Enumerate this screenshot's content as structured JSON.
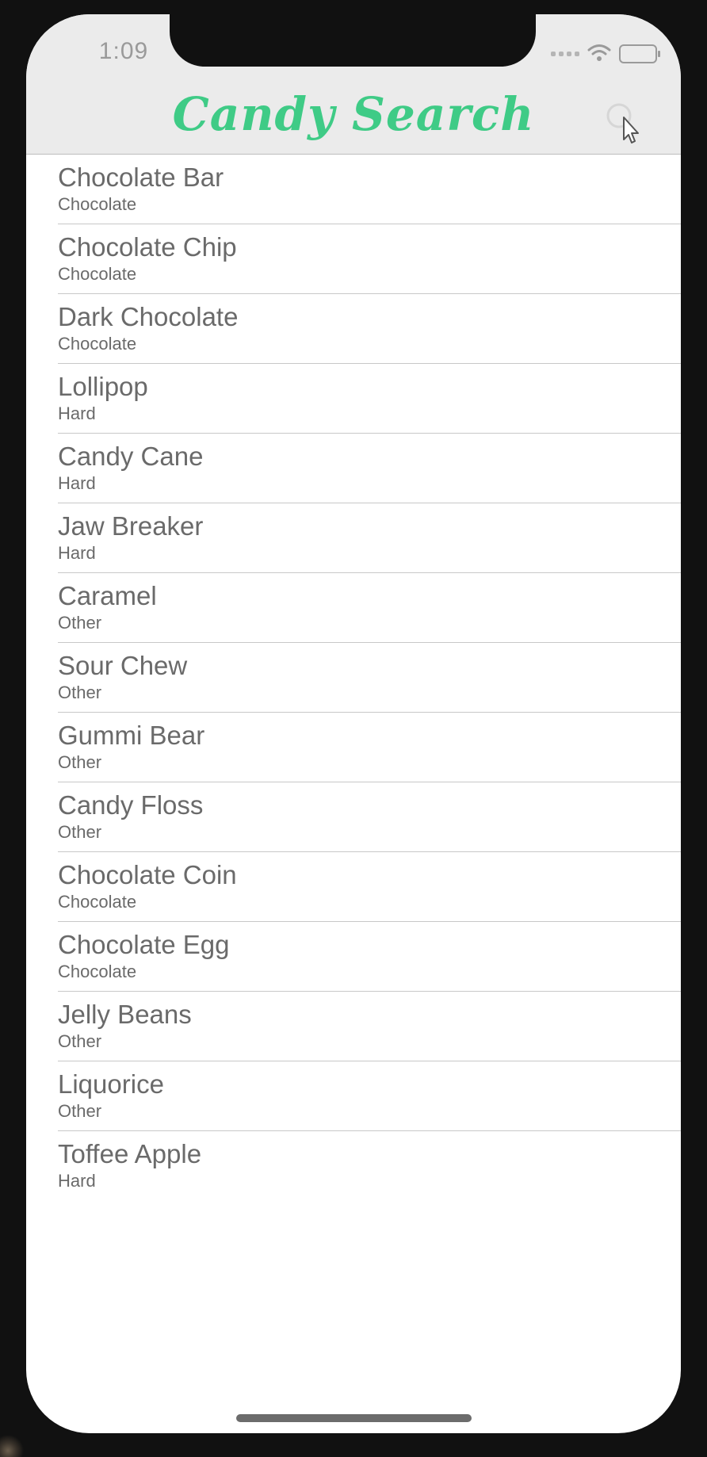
{
  "status_bar": {
    "time": "1:09"
  },
  "nav": {
    "title": "Candy Search",
    "title_color": "#3fcb86",
    "search_icon": "search-icon"
  },
  "candies": [
    {
      "name": "Chocolate Bar",
      "category": "Chocolate"
    },
    {
      "name": "Chocolate Chip",
      "category": "Chocolate"
    },
    {
      "name": "Dark Chocolate",
      "category": "Chocolate"
    },
    {
      "name": "Lollipop",
      "category": "Hard"
    },
    {
      "name": "Candy Cane",
      "category": "Hard"
    },
    {
      "name": "Jaw Breaker",
      "category": "Hard"
    },
    {
      "name": "Caramel",
      "category": "Other"
    },
    {
      "name": "Sour Chew",
      "category": "Other"
    },
    {
      "name": "Gummi Bear",
      "category": "Other"
    },
    {
      "name": "Candy Floss",
      "category": "Other"
    },
    {
      "name": "Chocolate Coin",
      "category": "Chocolate"
    },
    {
      "name": "Chocolate Egg",
      "category": "Chocolate"
    },
    {
      "name": "Jelly Beans",
      "category": "Other"
    },
    {
      "name": "Liquorice",
      "category": "Other"
    },
    {
      "name": "Toffee Apple",
      "category": "Hard"
    }
  ]
}
